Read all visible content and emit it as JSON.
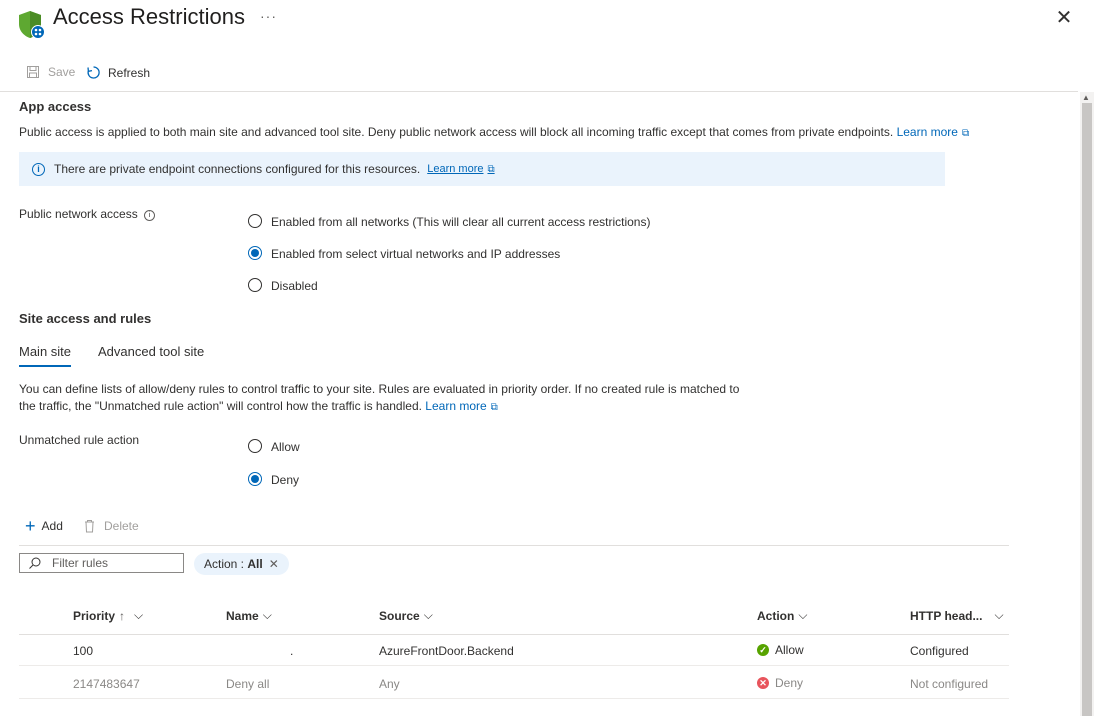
{
  "header": {
    "title": "Access Restrictions",
    "more": "···",
    "close": "✕"
  },
  "toolbar": {
    "save": "Save",
    "refresh": "Refresh"
  },
  "app_access": {
    "title": "App access",
    "description": "Public access is applied to both main site and advanced tool site. Deny public network access will block all incoming traffic except that comes from private endpoints.",
    "learn_more": "Learn more",
    "info": "There are private endpoint connections configured for this resources.",
    "info_learn_more": "Learn more",
    "public_network_label": "Public network access",
    "options": [
      "Enabled from all networks (This will clear all current access restrictions)",
      "Enabled from select virtual networks and IP addresses",
      "Disabled"
    ],
    "selected_index": 1
  },
  "site_access": {
    "title": "Site access and rules",
    "tabs": [
      "Main site",
      "Advanced tool site"
    ],
    "description_line1": "You can define lists of allow/deny rules to control traffic to your site. Rules are evaluated in priority order. If no created rule is matched to",
    "description_line2": "the traffic, the \"Unmatched rule action\" will control how the traffic is handled.",
    "learn_more": "Learn more",
    "unmatched_label": "Unmatched rule action",
    "unmatched_options": [
      "Allow",
      "Deny"
    ],
    "unmatched_selected_index": 1
  },
  "rules_toolbar": {
    "add": "Add",
    "delete": "Delete"
  },
  "filter": {
    "placeholder": "Filter rules",
    "pill_key": "Action : ",
    "pill_value": "All"
  },
  "table": {
    "columns": [
      "Priority",
      "Name",
      "Source",
      "Action",
      "HTTP head..."
    ],
    "priority_sort": "↑",
    "rows": [
      {
        "priority": "100",
        "name": ".",
        "source": "AzureFrontDoor.Backend",
        "action": "Allow",
        "http": "Configured"
      },
      {
        "priority": "2147483647",
        "name": "Deny all",
        "source": "Any",
        "action": "Deny",
        "http": "Not configured"
      }
    ]
  },
  "colors": {
    "accent": "#0067b8",
    "allow": "#57a300",
    "deny": "#e8545c",
    "info_bg": "#eaf3fc"
  }
}
